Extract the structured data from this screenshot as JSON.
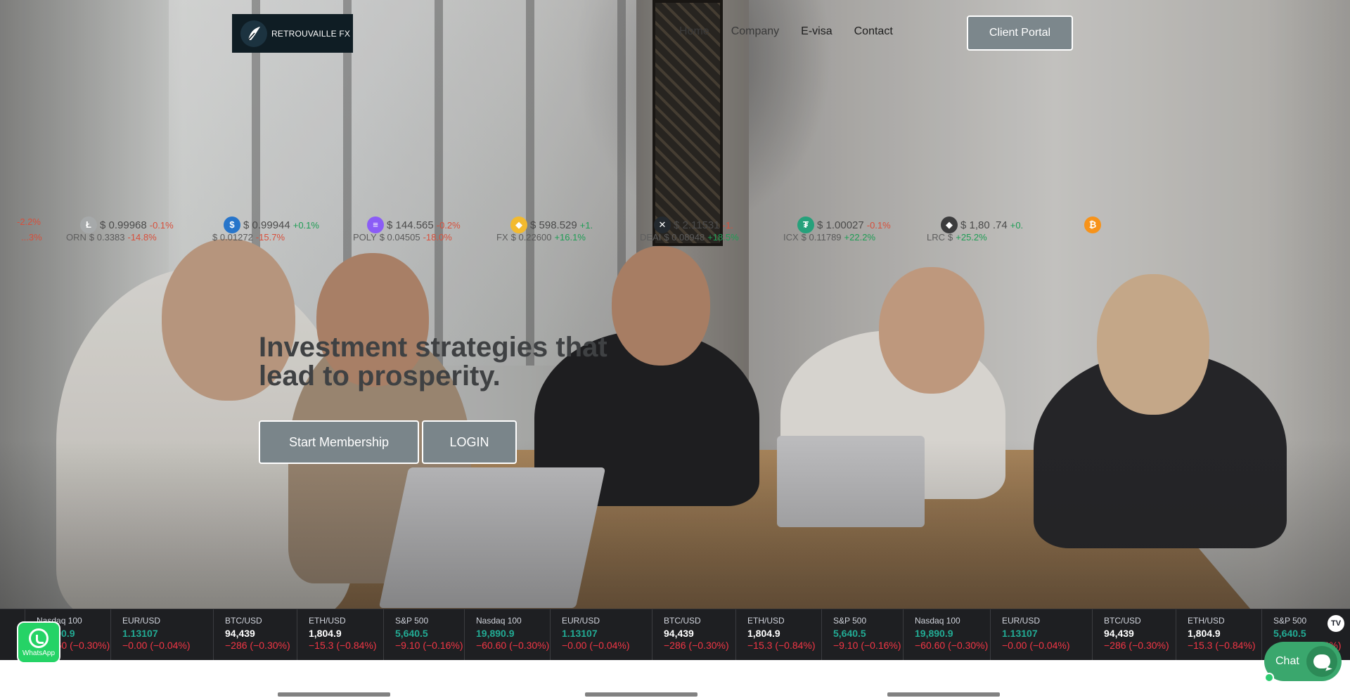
{
  "logo": {
    "text": "RETROUVAILLE FX"
  },
  "nav": {
    "items": [
      "Home",
      "Company",
      "E-visa",
      "Contact"
    ],
    "client_portal": "Client Portal"
  },
  "crypto_ticker": {
    "row1": [
      {
        "icon": "",
        "price": "",
        "change": "-2.2%",
        "dir": "neg"
      },
      {
        "icon": "litecoin-icon",
        "price": "$ 0.99968",
        "change": "-0.1%",
        "dir": "neg"
      },
      {
        "icon": "usdc-icon",
        "price": "$ 0.99944",
        "change": "+0.1%",
        "dir": "pos"
      },
      {
        "icon": "solana-icon",
        "price": "$ 144.565",
        "change": "-0.2%",
        "dir": "neg"
      },
      {
        "icon": "bnb-icon",
        "price": "$ 598.529",
        "change": "+1.",
        "dir": "pos"
      },
      {
        "icon": "xrp-icon",
        "price": "$ 2.11531",
        "change": "-1.",
        "dir": "neg"
      },
      {
        "icon": "tether-icon",
        "price": "$ 1.00027",
        "change": "-0.1%",
        "dir": "neg"
      },
      {
        "icon": "ethereum-icon",
        "price": "$ 1,80 .74",
        "change": "+0.",
        "dir": "pos"
      },
      {
        "icon": "bitcoin-icon",
        "price": "",
        "change": "",
        "dir": "pos"
      }
    ],
    "row2": [
      {
        "name": "",
        "price": "",
        "change": "...3%",
        "dir": "neg"
      },
      {
        "name": "ORN",
        "price": "$ 0.3383",
        "change": "-14.8%",
        "dir": "neg"
      },
      {
        "name": "",
        "price": "$ 0.01272",
        "change": "-15.7%",
        "dir": "neg"
      },
      {
        "name": "POLY",
        "price": "$ 0.04505",
        "change": "-18.0%",
        "dir": "neg"
      },
      {
        "name": "FX",
        "price": "$ 0.22600",
        "change": "+16.1%",
        "dir": "pos"
      },
      {
        "name": "DEAI",
        "price": "$ 0.08948",
        "change": "+18.5%",
        "dir": "pos"
      },
      {
        "name": "ICX",
        "price": "$ 0.11789",
        "change": "+22.2%",
        "dir": "pos"
      },
      {
        "name": "LRC",
        "price": "$",
        "change": "+25.2%",
        "dir": "pos"
      }
    ]
  },
  "hero": {
    "headline_line1": "Investment strategies that",
    "headline_line2": "lead to prosperity.",
    "start_button": "Start Membership",
    "login_button": "LOGIN"
  },
  "market_ticker": [
    {
      "symbol": "Nasdaq 100",
      "price": "19,890.9",
      "change": "−60.60 (−0.30%)",
      "price_color": "green"
    },
    {
      "symbol": "EUR/USD",
      "price": "1.13107",
      "change": "−0.00 (−0.04%)",
      "price_color": "green"
    },
    {
      "symbol": "BTC/USD",
      "price": "94,439",
      "change": "−286 (−0.30%)",
      "price_color": "white"
    },
    {
      "symbol": "ETH/USD",
      "price": "1,804.9",
      "change": "−15.3 (−0.84%)",
      "price_color": "white"
    },
    {
      "symbol": "S&P 500",
      "price": "5,640.5",
      "change": "−9.10 (−0.16%)",
      "price_color": "green"
    },
    {
      "symbol": "Nasdaq 100",
      "price": "19,890.9",
      "change": "−60.60 (−0.30%)",
      "price_color": "green"
    },
    {
      "symbol": "EUR/USD",
      "price": "1.13107",
      "change": "−0.00 (−0.04%)",
      "price_color": "green"
    },
    {
      "symbol": "BTC/USD",
      "price": "94,439",
      "change": "−286 (−0.30%)",
      "price_color": "white"
    },
    {
      "symbol": "ETH/USD",
      "price": "1,804.9",
      "change": "−15.3 (−0.84%)",
      "price_color": "white"
    },
    {
      "symbol": "S&P 500",
      "price": "5,640.5",
      "change": "−9.10 (−0.16%)",
      "price_color": "green"
    },
    {
      "symbol": "Nasdaq 100",
      "price": "19,890.9",
      "change": "−60.60 (−0.30%)",
      "price_color": "green"
    },
    {
      "symbol": "EUR/USD",
      "price": "1.13107",
      "change": "−0.00 (−0.04%)",
      "price_color": "green"
    },
    {
      "symbol": "BTC/USD",
      "price": "94,439",
      "change": "−286 (−0.30%)",
      "price_color": "white"
    },
    {
      "symbol": "ETH/USD",
      "price": "1,804.9",
      "change": "−15.3 (−0.84%)",
      "price_color": "white"
    },
    {
      "symbol": "S&P 500",
      "price": "5,640.5",
      "change": "−9.10 (−0.16%)",
      "price_color": "green"
    }
  ],
  "market_ticker_logo": "TV",
  "whatsapp": {
    "label": "WhatsApp"
  },
  "chat": {
    "label": "Chat"
  },
  "colors": {
    "accent": "#7a858a",
    "ticker_bg": "#1e1f22",
    "ticker_negative": "#f23645",
    "ticker_positive": "#22ab94",
    "whatsapp": "#25d366",
    "chat": "#3aa76d"
  }
}
